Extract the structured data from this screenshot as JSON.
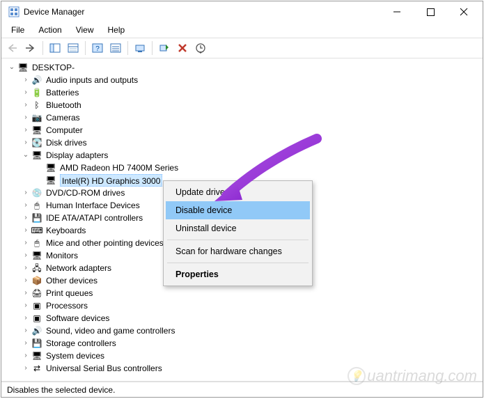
{
  "window": {
    "title": "Device Manager"
  },
  "menu": {
    "file": "File",
    "action": "Action",
    "view": "View",
    "help": "Help"
  },
  "tree": {
    "root": "DESKTOP-",
    "items": [
      {
        "label": "Audio inputs and outputs"
      },
      {
        "label": "Batteries"
      },
      {
        "label": "Bluetooth"
      },
      {
        "label": "Cameras"
      },
      {
        "label": "Computer"
      },
      {
        "label": "Disk drives"
      },
      {
        "label": "Display adapters",
        "expanded": true,
        "children": [
          {
            "label": "AMD Radeon HD 7400M Series"
          },
          {
            "label": "Intel(R) HD Graphics 3000",
            "selected": true
          }
        ]
      },
      {
        "label": "DVD/CD-ROM drives"
      },
      {
        "label": "Human Interface Devices"
      },
      {
        "label": "IDE ATA/ATAPI controllers"
      },
      {
        "label": "Keyboards"
      },
      {
        "label": "Mice and other pointing devices"
      },
      {
        "label": "Monitors"
      },
      {
        "label": "Network adapters"
      },
      {
        "label": "Other devices"
      },
      {
        "label": "Print queues"
      },
      {
        "label": "Processors"
      },
      {
        "label": "Software devices"
      },
      {
        "label": "Sound, video and game controllers"
      },
      {
        "label": "Storage controllers"
      },
      {
        "label": "System devices"
      },
      {
        "label": "Universal Serial Bus controllers"
      }
    ]
  },
  "context_menu": {
    "update": "Update driver",
    "disable": "Disable device",
    "uninstall": "Uninstall device",
    "scan": "Scan for hardware changes",
    "properties": "Properties"
  },
  "statusbar": "Disables the selected device.",
  "watermark": "uantrimang.com"
}
